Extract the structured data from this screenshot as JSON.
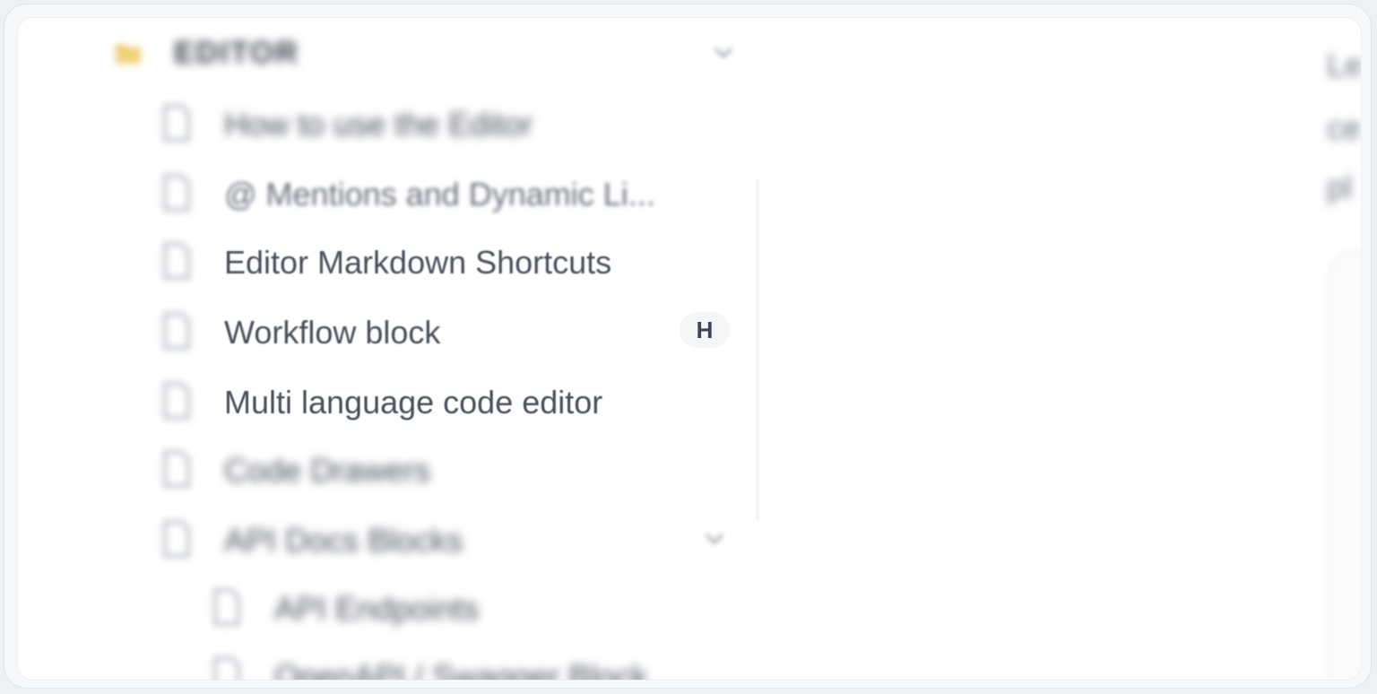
{
  "sidebar": {
    "section": {
      "title": "EDITOR",
      "folder_icon": "folder-icon",
      "toggle_icon": "chevron-down-icon"
    },
    "items": [
      {
        "label": "How to use the Editor",
        "icon": "document-icon"
      },
      {
        "label": "@ Mentions and Dynamic Li...",
        "icon": "document-icon"
      },
      {
        "label": "Editor Markdown Shortcuts",
        "icon": "document-icon"
      },
      {
        "label": "Workflow block",
        "icon": "document-icon",
        "shortcut": "H"
      },
      {
        "label": "Multi language code editor",
        "icon": "document-icon"
      },
      {
        "label": "Code Drawers",
        "icon": "document-icon"
      },
      {
        "label": "API Docs Blocks",
        "icon": "document-icon",
        "toggle_icon": "chevron-down-icon"
      },
      {
        "label": "API Endpoints",
        "icon": "document-icon",
        "nested": true
      },
      {
        "label": "OpenAPI / Swagger Block",
        "icon": "document-icon",
        "nested": true
      }
    ]
  },
  "content": {
    "text_fragments": [
      "Le",
      "ce",
      "pl"
    ]
  },
  "colors": {
    "text": "#4a505c",
    "muted": "#6b7280",
    "folder": "#e8c25a",
    "border": "#e1e4ea"
  }
}
